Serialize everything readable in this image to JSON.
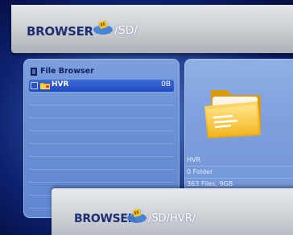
{
  "top_header": {
    "title": "BROWSER",
    "path": "/SD/"
  },
  "file_browser": {
    "title": "File Browser",
    "rows": [
      {
        "name": "HVR",
        "size": "0B",
        "selected": true
      },
      {
        "name": "",
        "size": ""
      },
      {
        "name": "",
        "size": ""
      },
      {
        "name": "",
        "size": ""
      },
      {
        "name": "",
        "size": ""
      },
      {
        "name": "",
        "size": ""
      },
      {
        "name": "",
        "size": ""
      },
      {
        "name": "",
        "size": ""
      },
      {
        "name": "",
        "size": ""
      },
      {
        "name": "",
        "size": ""
      },
      {
        "name": "",
        "size": ""
      }
    ]
  },
  "details": {
    "name": "HVR",
    "type": "0 Folder",
    "summary": "363 Files, 9GB"
  },
  "bottom_header": {
    "title": "BROWSER",
    "path": "/SD/HVR/"
  },
  "colors": {
    "accent": "#1f4bc2",
    "panel": "#6e92d6",
    "header_text": "#1d2f6e",
    "folder": "#f2b51c"
  },
  "icons": {
    "sd_card": "sd-card-icon",
    "doc": "document-icon",
    "folder": "folder-icon"
  }
}
